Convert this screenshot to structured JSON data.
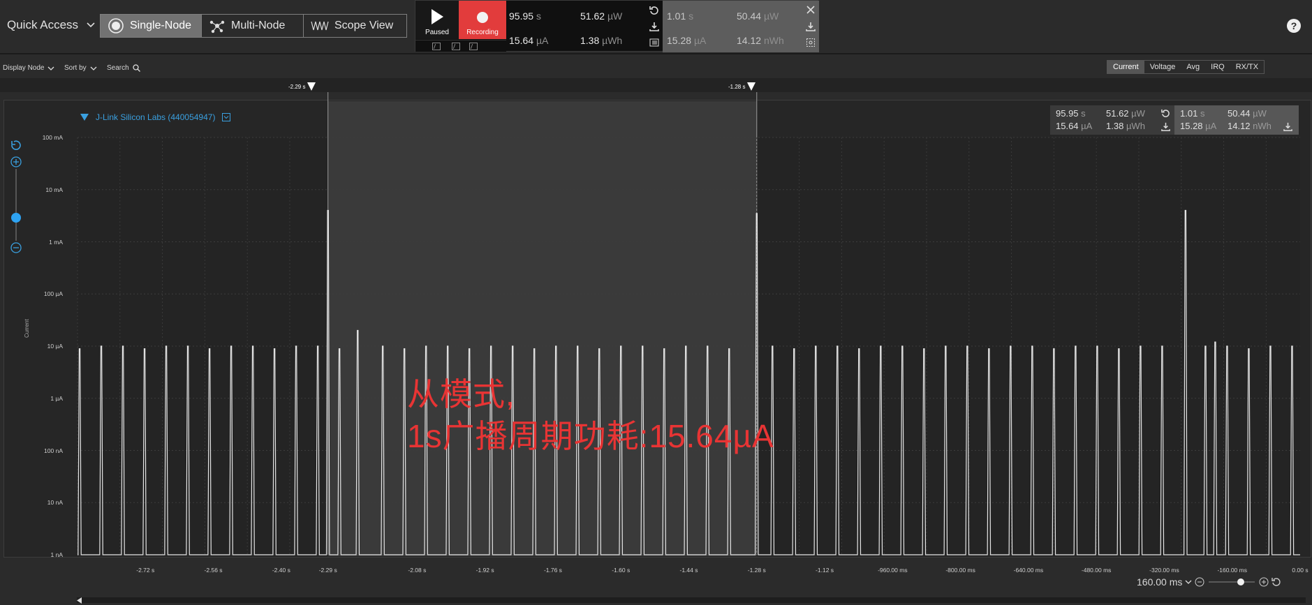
{
  "colors": {
    "accent": "#3aa0e0",
    "record": "#e23c3c",
    "annotation": "#e83434",
    "trace": "#e6e6e6"
  },
  "topbar": {
    "quick_access": "Quick Access",
    "modes": [
      {
        "label": "Single-Node",
        "icon": "target-icon",
        "active": true
      },
      {
        "label": "Multi-Node",
        "icon": "nodes-icon",
        "active": false
      },
      {
        "label": "Scope View",
        "icon": "wave-icon",
        "active": false
      }
    ],
    "play_label": "Paused",
    "record_label": "Recording",
    "stats": {
      "time": "95.95",
      "time_unit": "s",
      "current": "15.64",
      "current_unit": "µA",
      "power": "51.62",
      "power_unit": "µW",
      "energy": "1.38",
      "energy_unit": "µWh",
      "sel_time": "1.01",
      "sel_time_unit": "s",
      "sel_current": "15.28",
      "sel_current_unit": "µA",
      "sel_power": "50.44",
      "sel_power_unit": "µW",
      "sel_energy": "14.12",
      "sel_energy_unit": "nWh"
    }
  },
  "toolbar2": {
    "display_node": "Display Node",
    "sort_by": "Sort by",
    "search": "Search",
    "tabs": [
      "Current",
      "Voltage",
      "Avg",
      "IRQ",
      "RX/TX"
    ],
    "active_tab": "Current"
  },
  "markers": [
    {
      "label": "-2.29 s"
    },
    {
      "label": "-1.28 s"
    }
  ],
  "channel": {
    "name": "J-Link Silicon Labs (440054947)"
  },
  "chart_data": {
    "type": "line",
    "ylabel": "Current",
    "yscale": "log",
    "ylim": [
      "1 nA",
      "100 mA"
    ],
    "yticks": [
      "100 mA",
      "10 mA",
      "1 mA",
      "100 µA",
      "10 µA",
      "1 µA",
      "100 nA",
      "10 nA",
      "1 nA"
    ],
    "xticks": [
      "-2.72 s",
      "-2.56 s",
      "-2.40 s",
      "-2.29 s",
      "-2.08 s",
      "-1.92 s",
      "-1.76 s",
      "-1.60 s",
      "-1.44 s",
      "-1.28 s",
      "-1.12 s",
      "-960.00 ms",
      "-800.00 ms",
      "-640.00 ms",
      "-480.00 ms",
      "-320.00 ms",
      "-160.00 ms",
      "0.00 s"
    ],
    "xlim": [
      -2.88,
      0
    ],
    "selection": [
      -2.29,
      -1.28
    ],
    "spike_period_s": 0.051,
    "small_peak_current": "≈10 µA",
    "big_peaks": [
      {
        "x": -2.29,
        "current": "≈4 mA"
      },
      {
        "x": -1.28,
        "current": "≈3.5 mA"
      },
      {
        "x": -0.27,
        "current": "≈4 mA"
      }
    ],
    "medium_peaks": [
      {
        "x": -2.22,
        "current": "≈20 µA"
      },
      {
        "x": -0.2,
        "current": "≈12 µA"
      }
    ],
    "stats": {
      "time": "95.95 s",
      "current": "15.64 µA",
      "power": "51.62 µW",
      "energy": "1.38 µWh",
      "sel_time": "1.01 s",
      "sel_current": "15.28 µA",
      "sel_power": "50.44 µW",
      "sel_energy": "14.12 nWh"
    }
  },
  "annotation": {
    "line1": "从模式,",
    "line2": "1s广播周期功耗:15.64µA"
  },
  "zoom": {
    "label": "160.00 ms"
  }
}
